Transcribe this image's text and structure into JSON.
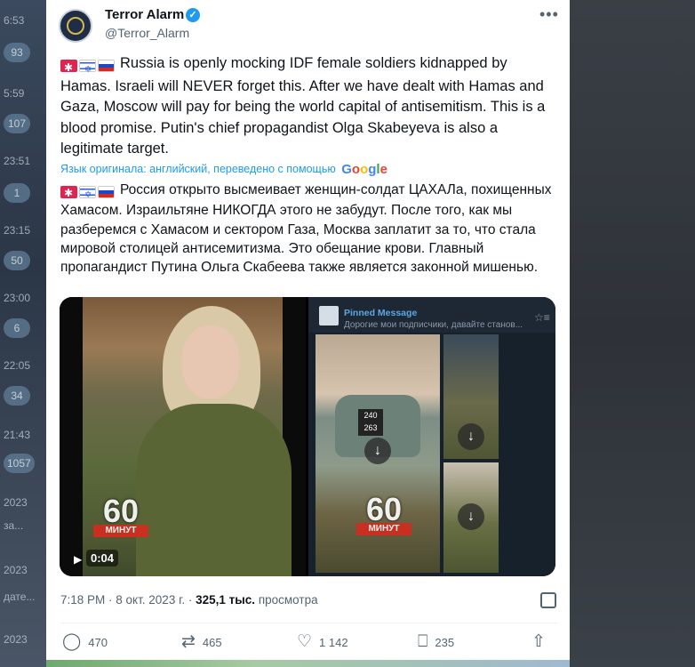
{
  "background": {
    "left_times": [
      "6:53",
      "5:59",
      "23:51",
      "23:15",
      "23:00",
      "22:05",
      "21:43",
      "2023",
      "2023",
      "2023"
    ],
    "left_badges": [
      "93",
      "107",
      "1",
      "50",
      "6",
      "34",
      "1057"
    ],
    "left_snippets": [
      "за...",
      "дате..."
    ]
  },
  "tweet": {
    "author_name": "Terror Alarm",
    "author_handle": "@Terror_Alarm",
    "more_label": "•••",
    "text_en": "Russia is openly mocking IDF female soldiers kidnapped by Hamas. Israeli will NEVER forget this. After we have dealt with Hamas and Gaza, Moscow will pay for being the world capital of antisemitism. This is a blood promise. Putin's chief propagandist Olga Skabeyeva is also a legitimate target.",
    "translation_notice": "Язык оригинала: английский, переведено с помощью",
    "translation_brand": [
      "G",
      "o",
      "o",
      "g",
      "l",
      "e"
    ],
    "text_ru": "Россия открыто высмеивает женщин-солдат ЦАХАЛа, похищенных Хамасом. Израильтяне НИКОГДА этого не забудут. После того, как мы разберемся с Хамасом и сектором Газа, Москва заплатит за то, что стала мировой столицей антисемитизма. Это обещание крови. Главный пропагандист Путина Ольга Скабеева также является законной мишенью.",
    "media": {
      "video1_duration": "0:04",
      "logo_number": "60",
      "logo_caption": "МИНУТ",
      "pinned_title": "Pinned Message",
      "pinned_text": "Дорогие мои подписчики, давайте станов...",
      "tag_text": "240 263"
    },
    "time": "7:18 PM",
    "date": "8 окт. 2023 г.",
    "views_count": "325,1 тыс.",
    "views_label": "просмотра",
    "replies": "470",
    "retweets": "465",
    "likes": "1 142",
    "bookmarks": "235"
  },
  "colors": {
    "accent": "#1d9bf0",
    "text_secondary": "#536471"
  }
}
